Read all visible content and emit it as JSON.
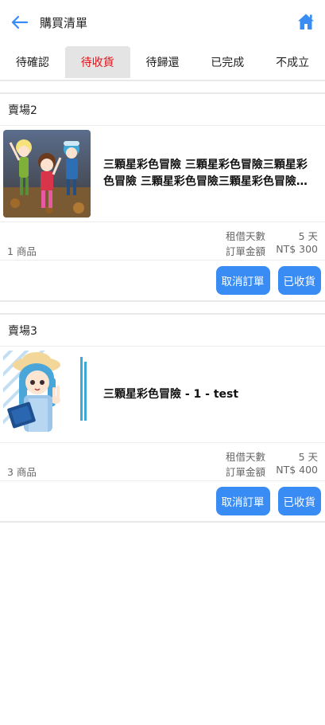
{
  "header": {
    "title": "購買清單",
    "back_icon": "arrow-left-icon",
    "home_icon": "home-icon",
    "accent_color": "#3a8cf5"
  },
  "tabs": [
    {
      "label": "待確認"
    },
    {
      "label": "待收貨",
      "active": true
    },
    {
      "label": "待歸還"
    },
    {
      "label": "已完成"
    },
    {
      "label": "不成立"
    }
  ],
  "orders": [
    {
      "shop": "賣場2",
      "product": {
        "name": "三顆星彩色冒險 三顆星彩色冒險三顆星彩色冒險 三顆星彩色冒險三顆星彩色冒險三顆星彩色冒險"
      },
      "item_count": "1 商品",
      "rental_days_label": "租借天數",
      "rental_days_value": "5 天",
      "total_label": "訂單金額",
      "total_value": "NT$ 300",
      "cancel_label": "取消訂單",
      "received_label": "已收貨"
    },
    {
      "shop": "賣場3",
      "product": {
        "name": "三顆星彩色冒險 - 1 - test"
      },
      "item_count": "3 商品",
      "rental_days_label": "租借天數",
      "rental_days_value": "5 天",
      "total_label": "訂單金額",
      "total_value": "NT$ 400",
      "cancel_label": "取消訂單",
      "received_label": "已收貨"
    }
  ]
}
